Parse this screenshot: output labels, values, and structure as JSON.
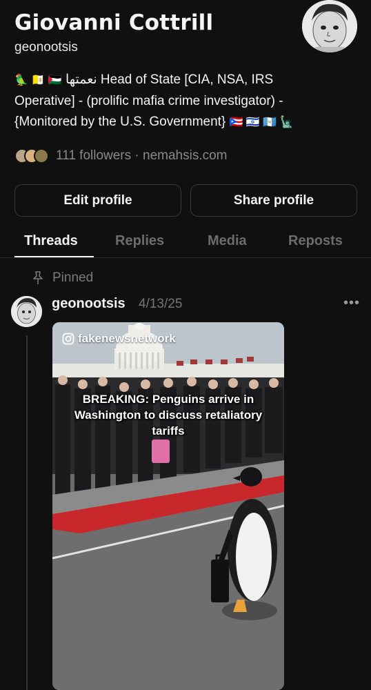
{
  "profile": {
    "display_name": "Giovanni Cottrill",
    "username": "geonootsis",
    "bio_line1_emoji": "🦜 🇻🇦 🇵🇸",
    "bio_line1_text": "نعمتها Head of State [CIA, NSA, IRS",
    "bio_line2": "Operative] - (prolific mafia crime investigator) -",
    "bio_line3_text": "{Monitored by the U.S. Government}",
    "bio_line3_emoji": "🇵🇷 🇮🇱 🇬🇹 🗽",
    "followers_text": "111 followers · nemahsis.com"
  },
  "buttons": {
    "edit_label": "Edit profile",
    "share_label": "Share profile"
  },
  "tabs": [
    {
      "label": "Threads",
      "active": true
    },
    {
      "label": "Replies",
      "active": false
    },
    {
      "label": "Media",
      "active": false
    },
    {
      "label": "Reposts",
      "active": false
    }
  ],
  "pinned_label": "Pinned",
  "post": {
    "username": "geonootsis",
    "date": "4/13/25",
    "more": "•••",
    "media": {
      "watermark": "fakenewsnetwork",
      "caption": "BREAKING: Penguins arrive in Washington to discuss retaliatory tariffs"
    }
  },
  "colors": {
    "background": "#101010",
    "text": "#f3f5f7",
    "muted": "#777777",
    "border": "#3a3a3a",
    "carpet": "#c8282b"
  }
}
